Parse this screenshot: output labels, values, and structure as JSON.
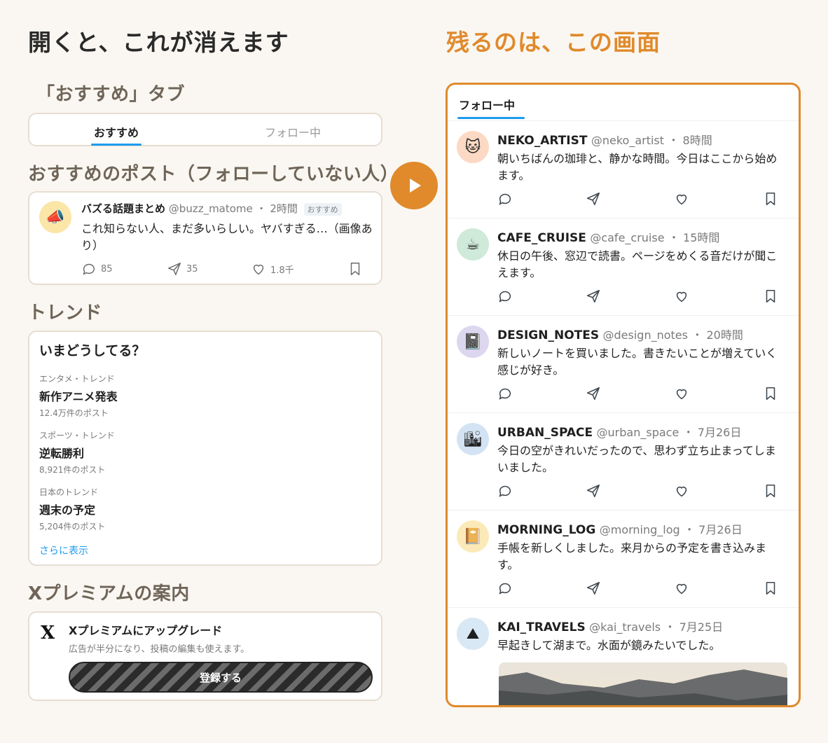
{
  "left": {
    "heading": "開くと、これが消えます",
    "tabs_section": {
      "title": "「おすすめ」タブ",
      "tab_active": "おすすめ",
      "tab_inactive": "フォロー中"
    },
    "recommended_section": {
      "title": "おすすめのポスト（フォローしていない人）",
      "post": {
        "avatar_icon": "megaphone-icon",
        "name": "バズる話題まとめ",
        "handle": "@buzz_matome",
        "time": "・ 2時間",
        "badge": "おすすめ",
        "text": "これ知らない人、まだ多いらしい。ヤバすぎる…（画像あり）",
        "replies": "85",
        "reposts": "35",
        "likes": "1.8千"
      }
    },
    "trends_section": {
      "title": "トレンド",
      "card_title": "いまどうしてる？",
      "items": [
        {
          "category": "エンタメ・トレンド",
          "name": "新作アニメ発表",
          "count": "12.4万件のポスト"
        },
        {
          "category": "スポーツ・トレンド",
          "name": "逆転勝利",
          "count": "8,921件のポスト"
        },
        {
          "category": "日本のトレンド",
          "name": "週末の予定",
          "count": "5,204件のポスト"
        }
      ],
      "show_more": "さらに表示"
    },
    "premium_section": {
      "title": "Xプレミアムの案内",
      "logo": "X",
      "card_title": "Xプレミアムにアップグレード",
      "card_sub": "広告が半分になり、投稿の編集も使えます。",
      "button": "登録する"
    }
  },
  "right": {
    "heading": "残るのは、この画面",
    "tab": "フォロー中",
    "posts": [
      {
        "avatar": "🐱",
        "avatar_bg": "#fbd9c4",
        "name": "NEKO_ARTIST",
        "handle": "@neko_artist",
        "time": "・ 8時間",
        "text": "朝いちばんの珈琲と、静かな時間。今日はここから始めます。"
      },
      {
        "avatar": "☕",
        "avatar_bg": "#cfead8",
        "name": "CAFE_CRUISE",
        "handle": "@cafe_cruise",
        "time": "・ 15時間",
        "text": "休日の午後、窓辺で読書。ページをめくる音だけが聞こえます。"
      },
      {
        "avatar": "📓",
        "avatar_bg": "#ddd6ef",
        "name": "DESIGN_NOTES",
        "handle": "@design_notes",
        "time": "・ 20時間",
        "text": "新しいノートを買いました。書きたいことが増えていく感じが好き。"
      },
      {
        "avatar": "🏙",
        "avatar_bg": "#d3e3f3",
        "name": "URBAN_SPACE",
        "handle": "@urban_space",
        "time": "・ 7月26日",
        "text": "今日の空がきれいだったので、思わず立ち止まってしまいました。"
      },
      {
        "avatar": "📔",
        "avatar_bg": "#fbeab8",
        "name": "MORNING_LOG",
        "handle": "@morning_log",
        "time": "・ 7月26日",
        "text": "手帳を新しくしました。来月からの予定を書き込みます。"
      },
      {
        "avatar": "⛰",
        "avatar_bg": "#d8e8f4",
        "name": "KAI_TRAVELS",
        "handle": "@kai_travels",
        "time": "・ 7月25日",
        "text": "早起きして湖まで。水面が鏡みたいでした。"
      }
    ]
  },
  "colors": {
    "accent": "#e08a2c",
    "link": "#1d9bf0",
    "card_border": "#e6ddd2"
  }
}
